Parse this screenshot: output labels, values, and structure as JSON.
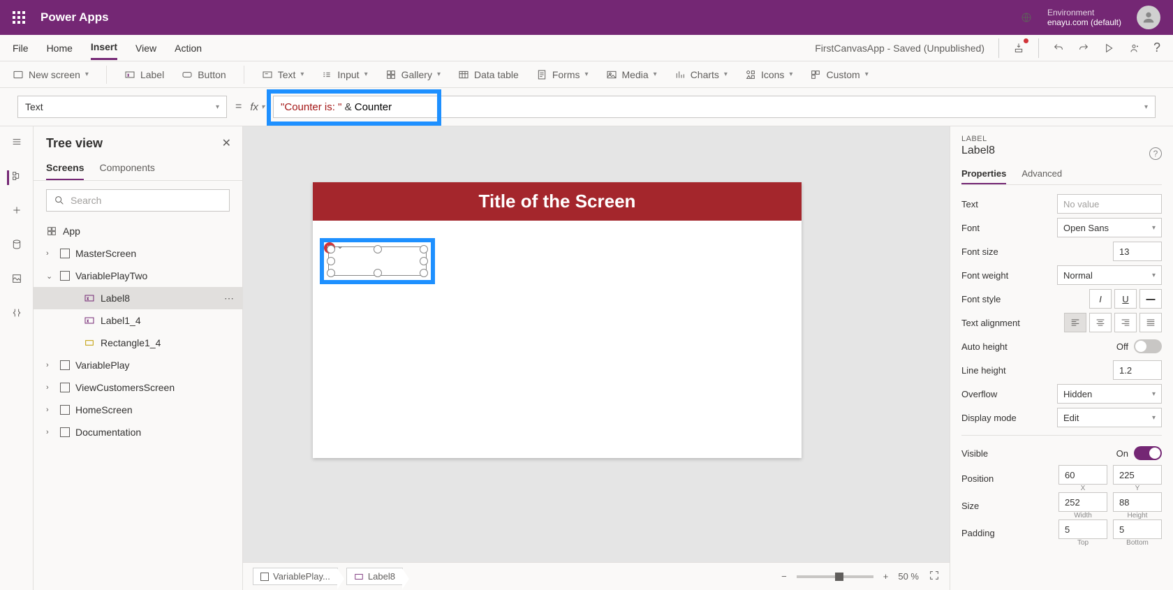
{
  "header": {
    "appName": "Power Apps",
    "envLabel": "Environment",
    "envName": "enayu.com (default)"
  },
  "menubar": {
    "items": [
      "File",
      "Home",
      "Insert",
      "View",
      "Action"
    ],
    "activeIndex": 2,
    "docStatus": "FirstCanvasApp - Saved (Unpublished)"
  },
  "ribbon": {
    "newScreen": "New screen",
    "items": [
      "Label",
      "Button",
      "Text",
      "Input",
      "Gallery",
      "Data table",
      "Forms",
      "Media",
      "Charts",
      "Icons",
      "Custom"
    ]
  },
  "formulaBar": {
    "property": "Text",
    "formulaString": "\"Counter is: \"",
    "formulaOp": " & ",
    "formulaVar": "Counter"
  },
  "treeview": {
    "title": "Tree view",
    "tabs": [
      "Screens",
      "Components"
    ],
    "activeTab": 0,
    "searchPlaceholder": "Search",
    "nodes": {
      "app": "App",
      "screens": [
        "MasterScreen",
        "VariablePlayTwo",
        "VariablePlay",
        "ViewCustomersScreen",
        "HomeScreen",
        "Documentation"
      ],
      "expandedScreen": "VariablePlayTwo",
      "children": [
        "Label8",
        "Label1_4",
        "Rectangle1_4"
      ],
      "selectedChild": "Label8"
    }
  },
  "canvas": {
    "screenTitle": "Title of the Screen"
  },
  "breadcrumb": {
    "items": [
      "VariablePlay...",
      "Label8"
    ],
    "zoom": "50 %"
  },
  "properties": {
    "typeLabel": "LABEL",
    "name": "Label8",
    "tabs": [
      "Properties",
      "Advanced"
    ],
    "activeTab": 0,
    "text": {
      "label": "Text",
      "placeholder": "No value"
    },
    "font": {
      "label": "Font",
      "value": "Open Sans"
    },
    "fontSize": {
      "label": "Font size",
      "value": "13"
    },
    "fontWeight": {
      "label": "Font weight",
      "value": "Normal"
    },
    "fontStyle": {
      "label": "Font style"
    },
    "textAlign": {
      "label": "Text alignment"
    },
    "autoHeight": {
      "label": "Auto height",
      "value": "Off"
    },
    "lineHeight": {
      "label": "Line height",
      "value": "1.2"
    },
    "overflow": {
      "label": "Overflow",
      "value": "Hidden"
    },
    "displayMode": {
      "label": "Display mode",
      "value": "Edit"
    },
    "visible": {
      "label": "Visible",
      "value": "On"
    },
    "position": {
      "label": "Position",
      "x": "60",
      "y": "225",
      "xLabel": "X",
      "yLabel": "Y"
    },
    "size": {
      "label": "Size",
      "w": "252",
      "h": "88",
      "wLabel": "Width",
      "hLabel": "Height"
    },
    "padding": {
      "label": "Padding",
      "top": "5",
      "bottom": "5",
      "topLabel": "Top",
      "bottomLabel": "Bottom"
    }
  }
}
